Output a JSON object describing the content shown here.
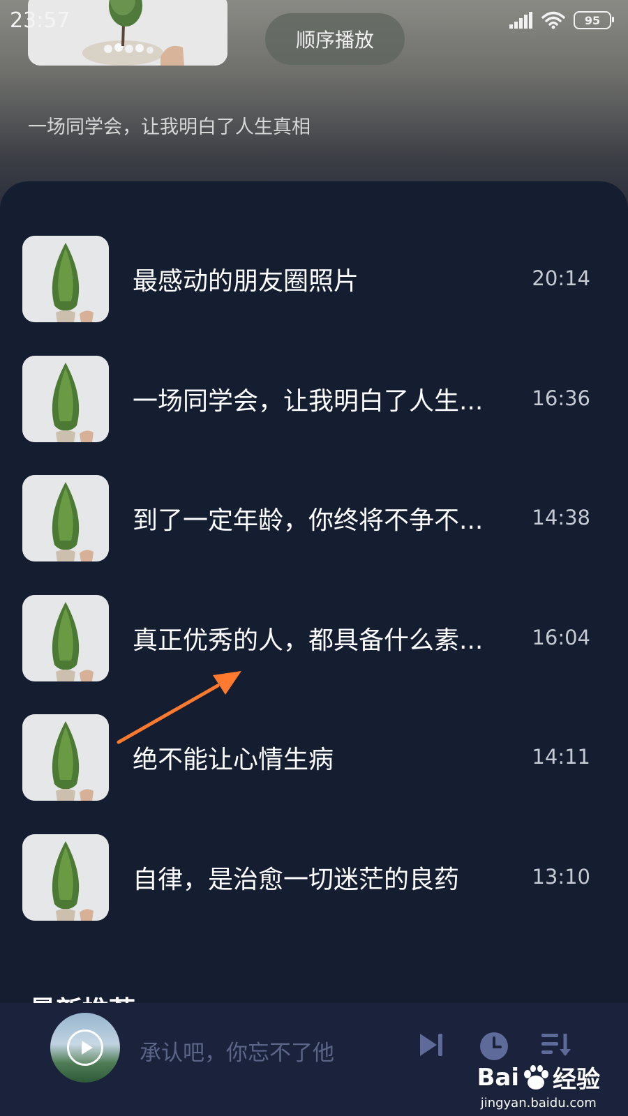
{
  "status_bar": {
    "time": "23:57",
    "battery": "95"
  },
  "header": {
    "play_mode_label": "顺序播放",
    "album_description": "一场同学会，让我明白了人生真相"
  },
  "tracks": [
    {
      "title": "最感动的朋友圈照片",
      "duration": "20:14"
    },
    {
      "title": "一场同学会，让我明白了人生...",
      "duration": "16:36"
    },
    {
      "title": "到了一定年龄，你终将不争不...",
      "duration": "14:38"
    },
    {
      "title": "真正优秀的人，都具备什么素...",
      "duration": "16:04"
    },
    {
      "title": "绝不能让心情生病",
      "duration": "14:11"
    },
    {
      "title": "自律，是治愈一切迷茫的良药",
      "duration": "13:10"
    }
  ],
  "section_heading": "最新推荐",
  "player": {
    "now_playing": "承认吧，你忘不了他"
  },
  "watermark": {
    "logo_text": "Bai",
    "logo_text_2": "经验",
    "url": "jingyan.baidu.com"
  },
  "icons": {
    "next": "skip-next-icon",
    "timer": "clock-icon",
    "playlist": "playlist-icon",
    "signal": "signal-icon",
    "wifi": "wifi-icon"
  },
  "colors": {
    "panel_bg": "#151d31",
    "player_bg": "#1b233c",
    "arrow": "#ff7a2e",
    "control_icon": "#5d6a9a"
  }
}
